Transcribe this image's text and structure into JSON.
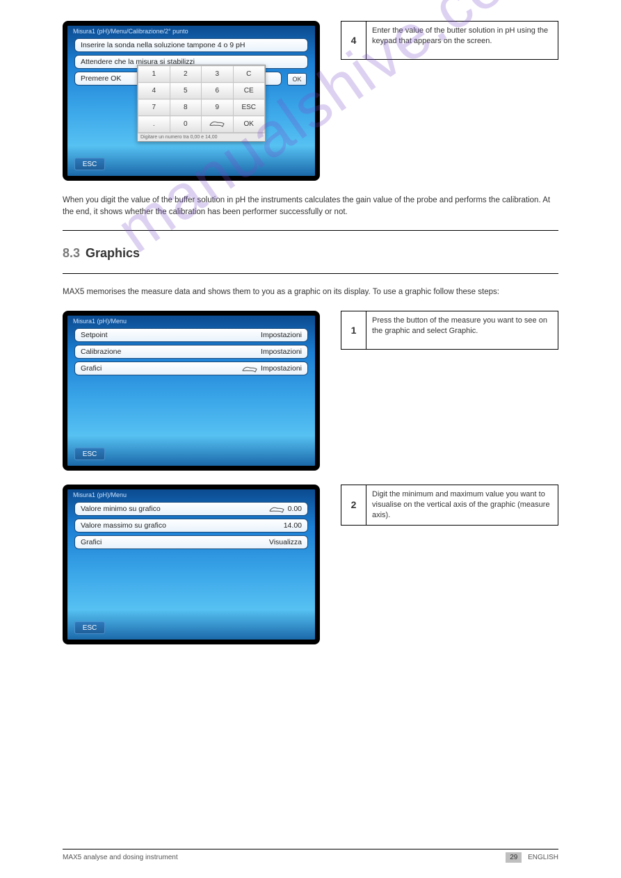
{
  "watermark": "manualshive.com",
  "screen1": {
    "breadcrumb": "Misura1 (pH)/Menu/Calibrazione/2° punto",
    "line1": "Inserire la sonda nella soluzione tampone 4 o 9 pH",
    "line2": "Attendere che la misura si stabilizzi",
    "line3_left": "Premere OK",
    "ok": "OK",
    "esc": "ESC",
    "keypad": {
      "r1": [
        "1",
        "2",
        "3",
        "C"
      ],
      "r2": [
        "4",
        "5",
        "6",
        "CE"
      ],
      "r3": [
        "7",
        "8",
        "9",
        "ESC"
      ],
      "r4": [
        ".",
        "0",
        "",
        "OK"
      ],
      "footer": "Digitare un numero tra 0,00 e 14,00"
    }
  },
  "caption1": {
    "num": "4",
    "text": "Enter the value of the butter solution in pH using the keypad that appears on the screen."
  },
  "para1": "When you digit the value of the buffer solution in pH the instruments calculates the gain value of the probe and performs the calibration. At the end, it shows whether the calibration has been performer successfully or not.",
  "section": {
    "num": "8.3",
    "title": "Graphics"
  },
  "para2": "MAX5 memorises the measure data and shows them to you as a graphic on its display. To use a graphic follow these steps:",
  "screen2": {
    "breadcrumb": "Misura1 (pH)/Menu",
    "rows": [
      {
        "left": "Setpoint",
        "right": "Impostazioni"
      },
      {
        "left": "Calibrazione",
        "right": "Impostazioni"
      },
      {
        "left": "Grafici",
        "right": "Impostazioni"
      }
    ],
    "esc": "ESC"
  },
  "caption2": {
    "num": "1",
    "text": "Press the button of the measure you want to see on the graphic and select Graphic."
  },
  "screen3": {
    "breadcrumb": "Misura1 (pH)/Menu",
    "rows": [
      {
        "left": "Valore minimo su grafico",
        "right": "0.00"
      },
      {
        "left": "Valore massimo su grafico",
        "right": "14.00"
      },
      {
        "left": "Grafici",
        "right": "Visualizza"
      }
    ],
    "esc": "ESC"
  },
  "caption3": {
    "num": "2",
    "text": "Digit the minimum and maximum value you want to visualise on the vertical axis of the graphic (measure axis)."
  },
  "footer": {
    "left": "MAX5 analyse and dosing instrument",
    "page": "29",
    "right": "ENGLISH"
  }
}
